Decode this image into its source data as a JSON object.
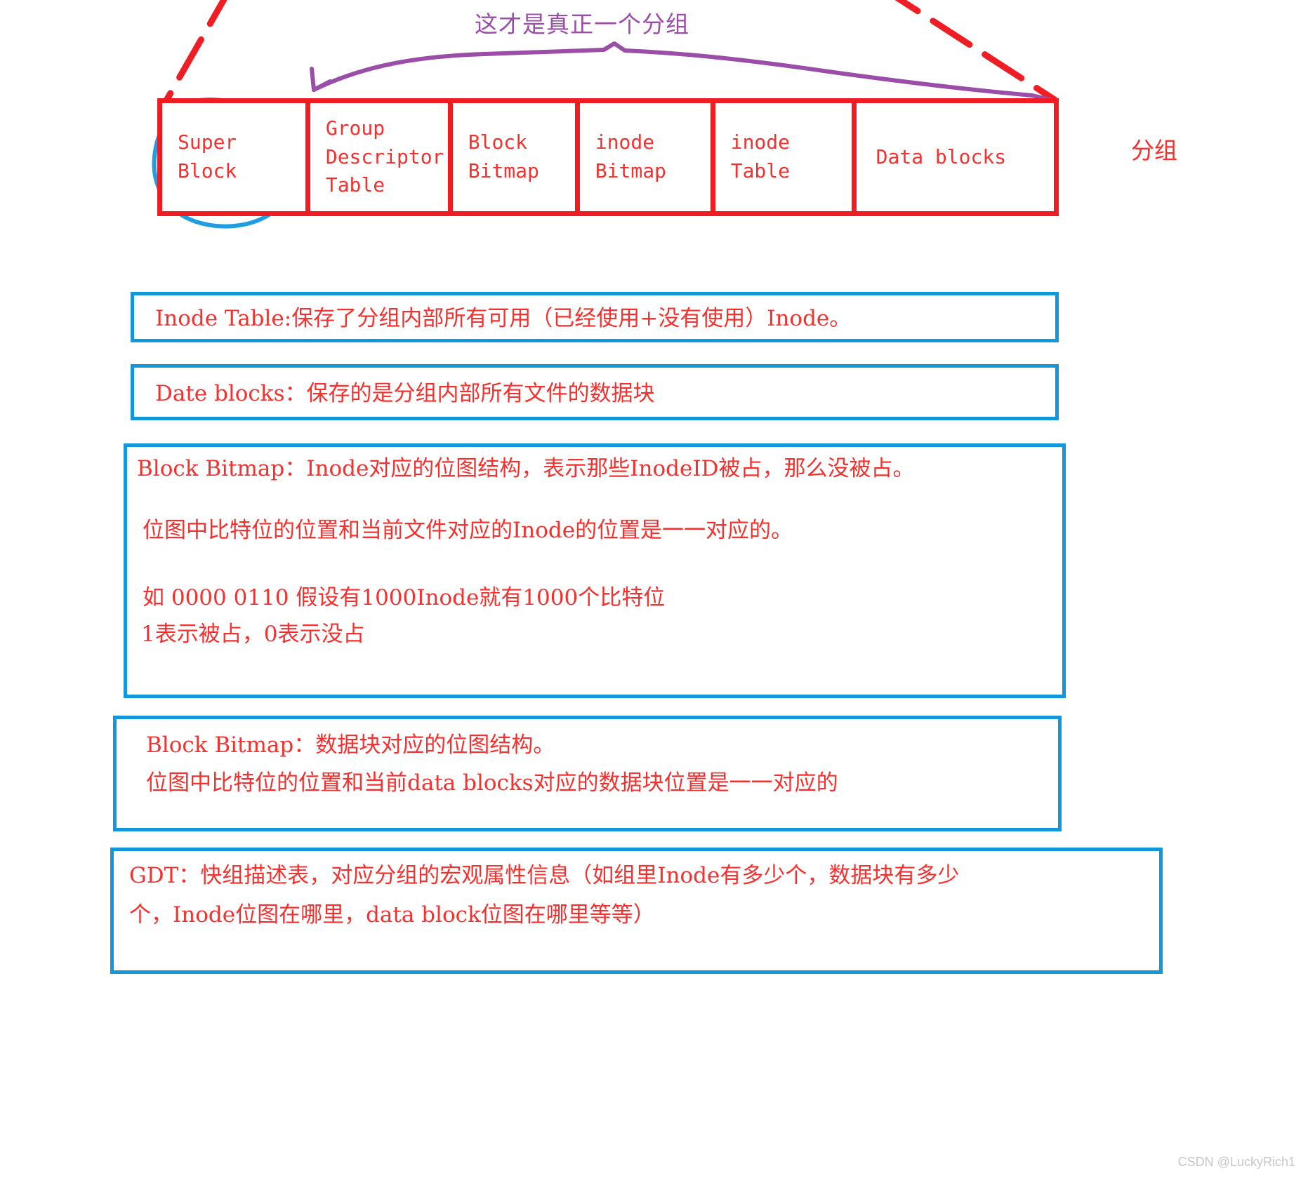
{
  "diagram": {
    "caption": "这才是真正一个分组",
    "right_label": "分组",
    "cells": [
      {
        "name": "super-block",
        "label": "Super\nBlock"
      },
      {
        "name": "group-descriptor-table",
        "label": "Group\nDescriptor\nTable"
      },
      {
        "name": "block-bitmap",
        "label": "Block\nBitmap"
      },
      {
        "name": "inode-bitmap",
        "label": "inode\nBitmap"
      },
      {
        "name": "inode-table",
        "label": "inode\nTable"
      },
      {
        "name": "data-blocks",
        "label": "Data blocks"
      }
    ]
  },
  "notes": {
    "inode_table": {
      "line1": "Inode Table:保存了分组内部所有可用（已经使用+没有使用）Inode。"
    },
    "data_blocks": {
      "line1": "Date blocks：保存的是分组内部所有文件的数据块"
    },
    "block_bitmap_inode": {
      "line1": "Block Bitmap：Inode对应的位图结构，表示那些InodeID被占，那么没被占。",
      "line2": "位图中比特位的位置和当前文件对应的Inode的位置是一一对应的。",
      "line3": "如 0000 0110    假设有1000Inode就有1000个比特位",
      "line4": "1表示被占，0表示没占"
    },
    "block_bitmap_data": {
      "line1": "Block Bitmap：数据块对应的位图结构。",
      "line2": "位图中比特位的位置和当前data blocks对应的数据块位置是一一对应的"
    },
    "gdt": {
      "line1": "GDT：快组描述表，对应分组的宏观属性信息（如组里Inode有多少个，数据块有多少",
      "line2": "个，Inode位图在哪里，data block位图在哪里等等）"
    }
  },
  "watermark": "CSDN @LuckyRich1",
  "colors": {
    "red": "#f4312e",
    "blue": "#1296dc",
    "purple": "#9b4ea8",
    "strip_border": "#f01c22"
  }
}
